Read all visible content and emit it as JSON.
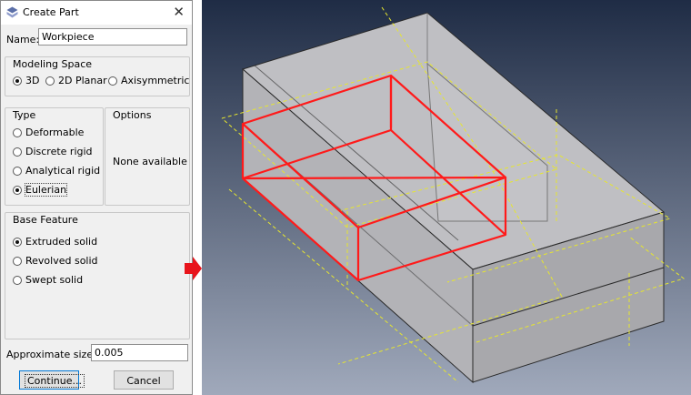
{
  "dialog": {
    "title": "Create Part",
    "name_label": "Name:",
    "name_value": "Workpiece",
    "modeling_space": {
      "title": "Modeling Space",
      "options": [
        "3D",
        "2D Planar",
        "Axisymmetric"
      ],
      "selected": "3D"
    },
    "type": {
      "title": "Type",
      "options": [
        "Deformable",
        "Discrete rigid",
        "Analytical rigid",
        "Eulerian"
      ],
      "selected": "Eulerian"
    },
    "options_group": {
      "title": "Options",
      "text": "None available"
    },
    "base_feature": {
      "title": "Base Feature",
      "options": [
        "Extruded solid",
        "Revolved solid",
        "Swept solid"
      ],
      "selected": "Extruded solid"
    },
    "size_label": "Approximate size:",
    "size_value": "0.005",
    "continue_label": "Continue...",
    "cancel_label": "Cancel"
  },
  "colors": {
    "highlight_edges": "#ff1a1a",
    "datum_lines": "#e6e62e",
    "viewport_top": "#1f2c45",
    "viewport_bottom": "#a0a9bb",
    "arrow": "#e8141b"
  }
}
